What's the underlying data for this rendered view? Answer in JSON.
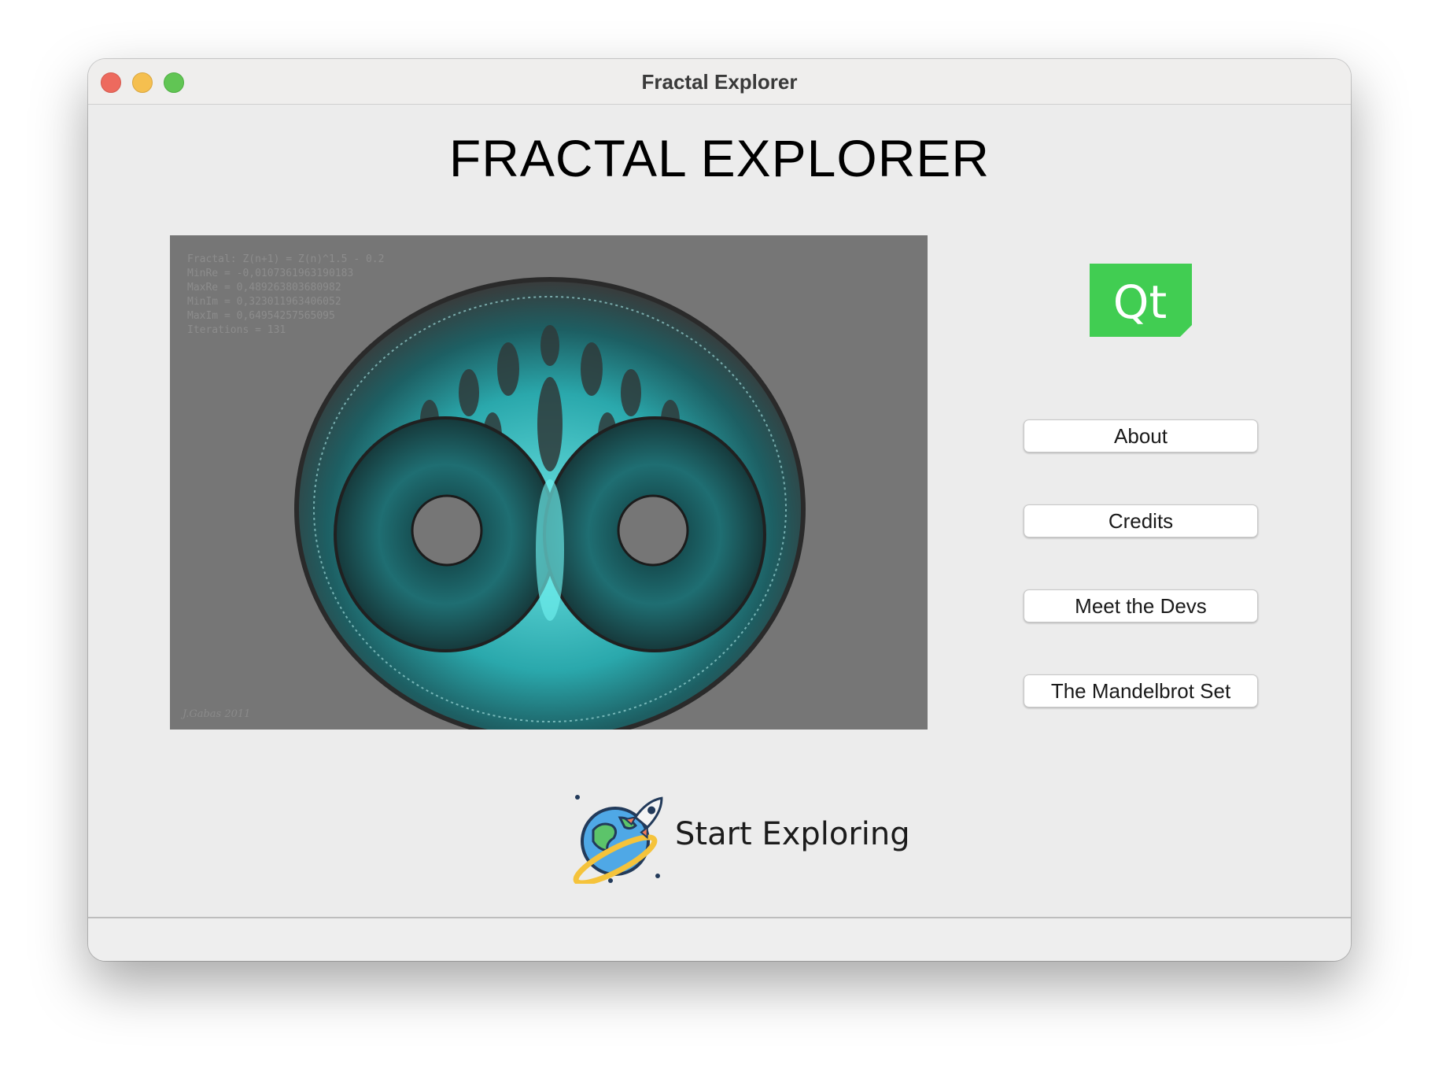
{
  "window": {
    "title": "Fractal Explorer"
  },
  "main": {
    "heading": "FRACTAL EXPLORER",
    "fractal_image": {
      "info_lines": [
        "Fractal: Z(n+1) = Z(n)^1.5 - 0.2",
        "MinRe = -0,0107361963190183",
        "MaxRe = 0,489263803680982",
        "MinIm = 0,323011963406052",
        "MaxIm = 0,64954257565095",
        "Iterations = 131"
      ],
      "signature": "J.Gabas 2011"
    },
    "qt_logo_text": "Qt",
    "buttons": {
      "about": "About",
      "credits": "Credits",
      "devs": "Meet the Devs",
      "mandelbrot": "The Mandelbrot Set"
    },
    "start": {
      "label": "Start Exploring",
      "icon": "globe-rocket-icon"
    }
  },
  "colors": {
    "qt_green": "#41cd52",
    "fractal_bg": "#767676",
    "fractal_teal": "#3fd0d4"
  }
}
